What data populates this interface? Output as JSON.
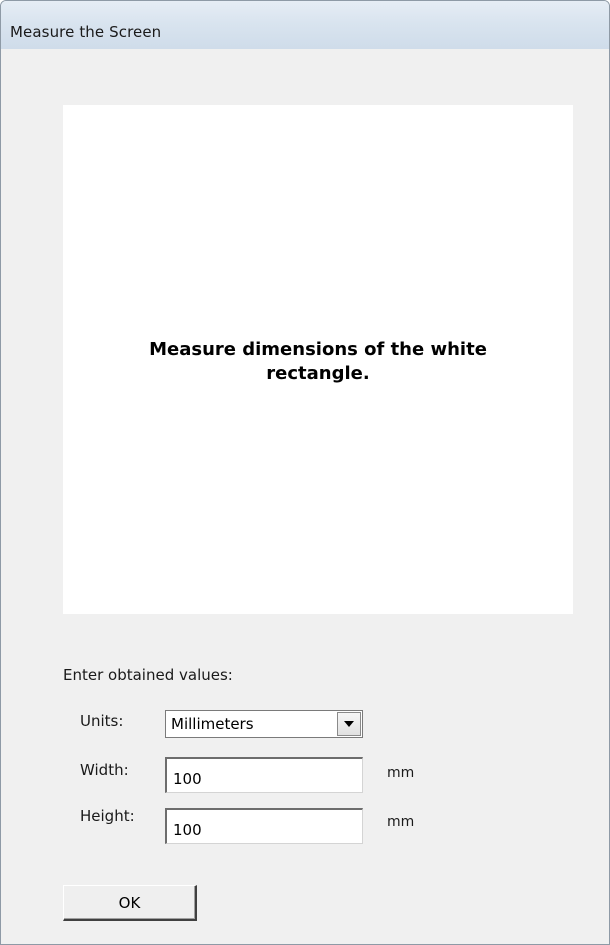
{
  "window": {
    "title": "Measure the Screen"
  },
  "instruction": "Measure dimensions of the white rectangle.",
  "form": {
    "section_label": "Enter obtained values:",
    "units": {
      "label": "Units:",
      "selected": "Millimeters"
    },
    "width": {
      "label": "Width:",
      "value": "100",
      "unit": "mm"
    },
    "height": {
      "label": "Height:",
      "value": "100",
      "unit": "mm"
    }
  },
  "buttons": {
    "ok": "OK"
  }
}
